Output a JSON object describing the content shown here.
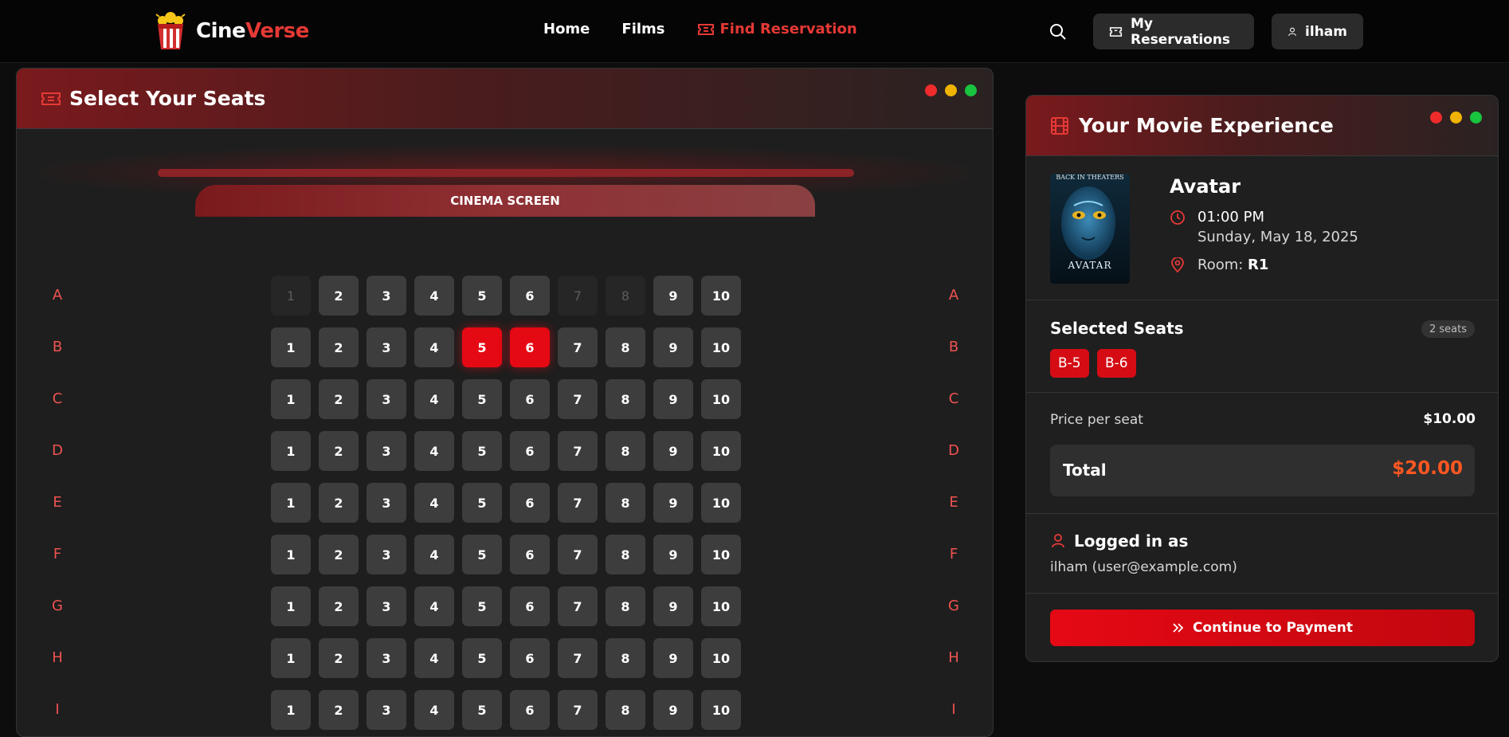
{
  "brand": {
    "name_a": "Cine",
    "name_b": "Verse",
    "color": "#e53935"
  },
  "nav": {
    "home": "Home",
    "films": "Films",
    "find_reservation": "Find Reservation"
  },
  "header": {
    "my_reservations": "My Reservations",
    "user": "ilham"
  },
  "seat_panel": {
    "title": "Select Your Seats",
    "screen_label": "CINEMA SCREEN",
    "rows": [
      "A",
      "B",
      "C",
      "D",
      "E",
      "F",
      "G",
      "H",
      "I"
    ],
    "seats_per_row": 10,
    "taken": [
      "A-1",
      "A-7",
      "A-8"
    ],
    "selected": [
      "B-5",
      "B-6"
    ]
  },
  "summary": {
    "title": "Your Movie Experience",
    "movie_title": "Avatar",
    "time": "01:00 PM",
    "date": "Sunday, May 18, 2025",
    "room_label": "Room: ",
    "room": "R1",
    "poster_top_text": "BACK IN THEATERS",
    "poster_logo": "AVATAR",
    "selected_title": "Selected Seats",
    "selected_count": "2 seats",
    "selected_seats": [
      "B-5",
      "B-6"
    ],
    "price_label": "Price per seat",
    "price": "$10.00",
    "total_label": "Total",
    "total": "$20.00",
    "logged_title": "Logged in as",
    "logged_user": "ilham (user@example.com)",
    "continue_label": "Continue to Payment"
  },
  "colors": {
    "accent": "#e50914",
    "total": "#ff5722",
    "row_label": "#ef5350"
  }
}
